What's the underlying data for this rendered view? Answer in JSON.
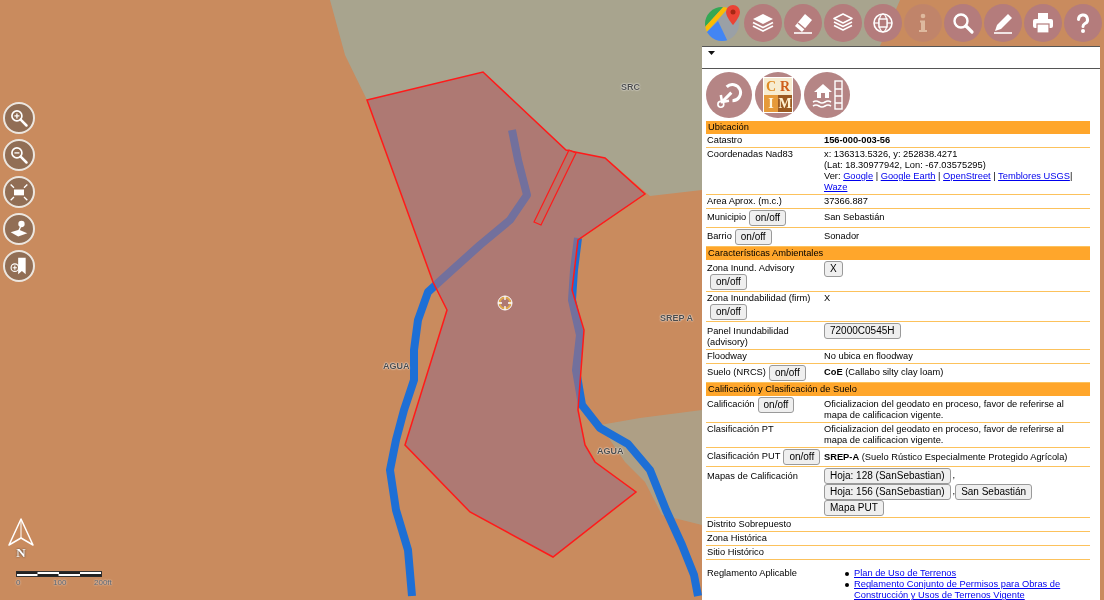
{
  "map": {
    "labels": [
      {
        "text": "SRC"
      },
      {
        "text": "SREP A"
      },
      {
        "text": "AGUA"
      },
      {
        "text": "AGUA"
      }
    ],
    "tools": [
      {
        "kind": "zoom_in"
      },
      {
        "kind": "zoom_out"
      },
      {
        "kind": "extent"
      },
      {
        "kind": "pin"
      },
      {
        "kind": "bookmark"
      }
    ],
    "north_arrow": {
      "label": "N"
    },
    "scale_bar": {
      "labels": [
        "0",
        "100",
        "200ft"
      ]
    }
  },
  "toolbar": [
    {
      "kind": "map",
      "disabled": false
    },
    {
      "kind": "layers",
      "disabled": false
    },
    {
      "kind": "eraser",
      "disabled": false
    },
    {
      "kind": "layers_alt",
      "disabled": false
    },
    {
      "kind": "globe",
      "disabled": false
    },
    {
      "kind": "info",
      "disabled": true
    },
    {
      "kind": "search",
      "disabled": false
    },
    {
      "kind": "draw",
      "disabled": false
    },
    {
      "kind": "print",
      "disabled": false
    },
    {
      "kind": "help",
      "disabled": false
    }
  ],
  "panel": {
    "shortcuts": [
      {
        "kind": "link"
      },
      {
        "kind": "logo",
        "letters": [
          "C",
          "R",
          "I",
          "M"
        ]
      },
      {
        "kind": "flood"
      }
    ],
    "sections": [
      {
        "title": "Ubicación",
        "rows": [
          {
            "label": "Catastro",
            "lines": [
              [
                {
                  "kind": "strong",
                  "text": "156-000-003-56"
                }
              ]
            ]
          },
          {
            "label": "Coordenadas Nad83",
            "lines": [
              [
                {
                  "kind": "text",
                  "text": "x: 136313.5326, y: 252838.4271"
                }
              ],
              [
                {
                  "kind": "text",
                  "text": "(Lat: 18.30977942, Lon: -67.03575295)"
                }
              ],
              [
                {
                  "kind": "text",
                  "text": "Ver: "
                },
                {
                  "kind": "link",
                  "text": "Google"
                },
                {
                  "kind": "sep",
                  "text": " | "
                },
                {
                  "kind": "link",
                  "text": "Google Earth"
                },
                {
                  "kind": "sep",
                  "text": " | "
                },
                {
                  "kind": "link",
                  "text": "OpenStreet"
                },
                {
                  "kind": "sep",
                  "text": " | "
                },
                {
                  "kind": "link",
                  "text": "Temblores USGS"
                },
                {
                  "kind": "sep",
                  "text": "| "
                },
                {
                  "kind": "link",
                  "text": "Waze"
                }
              ]
            ]
          },
          {
            "label": "Area Aprox. (m.c.)",
            "lines": [
              [
                {
                  "kind": "text",
                  "text": "37366.887"
                }
              ]
            ]
          },
          {
            "label": "Municipio",
            "toggle": "on/off",
            "lines": [
              [
                {
                  "kind": "text",
                  "text": "San Sebastián"
                }
              ]
            ]
          },
          {
            "label": "Barrio",
            "toggle": "on/off",
            "lines": [
              [
                {
                  "kind": "text",
                  "text": "Sonador"
                }
              ]
            ]
          }
        ]
      },
      {
        "title": "Características Ambientales",
        "rows": [
          {
            "label": "Zona Inund. Advisory",
            "toggle": "on/off",
            "lines": [
              [
                {
                  "kind": "button",
                  "text": "X"
                }
              ]
            ]
          },
          {
            "label": "Zona Inundabilidad (firm)",
            "toggle": "on/off",
            "lines": [
              [
                {
                  "kind": "text",
                  "text": "X"
                }
              ]
            ]
          },
          {
            "label": "Panel Inundabilidad (advisory)",
            "lines": [
              [
                {
                  "kind": "button",
                  "text": "72000C0545H"
                }
              ]
            ]
          },
          {
            "label": "Floodway",
            "lines": [
              [
                {
                  "kind": "text",
                  "text": "No ubica en floodway"
                }
              ]
            ]
          },
          {
            "label": "Suelo (NRCS)",
            "toggle": "on/off",
            "lines": [
              [
                {
                  "kind": "rich",
                  "text": "**CoE** (Callabo silty clay loam)"
                }
              ]
            ]
          }
        ]
      },
      {
        "title": "Calificación y Clasificación de Suelo",
        "rows": [
          {
            "label": "Calificación",
            "toggle": "on/off",
            "lines": [
              [
                {
                  "kind": "text",
                  "text": "Oficializacion del geodato en proceso, favor de referirse al mapa de calificacion vigente."
                }
              ]
            ]
          },
          {
            "label": "Clasificación PT",
            "lines": [
              [
                {
                  "kind": "text",
                  "text": "Oficializacion del geodato en proceso, favor de referirse al mapa de calificacion vigente."
                }
              ]
            ]
          },
          {
            "label": "Clasificación PUT",
            "toggle": "on/off",
            "lines": [
              [
                {
                  "kind": "rich",
                  "text": "**SREP-A** (Suelo Rústico Especialmente Protegido Agrícola)"
                }
              ]
            ]
          },
          {
            "label": "Mapas de Calificación",
            "lines": [
              [
                {
                  "kind": "button",
                  "text": "Hoja: 128 (SanSebastian)"
                },
                {
                  "kind": "sep",
                  "text": ","
                }
              ],
              [
                {
                  "kind": "button",
                  "text": "Hoja: 156 (SanSebastian)"
                },
                {
                  "kind": "sep",
                  "text": ","
                },
                {
                  "kind": "button",
                  "text": "San Sebastián"
                }
              ],
              [
                {
                  "kind": "button",
                  "text": "Mapa PUT"
                }
              ]
            ]
          },
          {
            "label": "Distrito Sobrepuesto"
          },
          {
            "label": "Zona Histórica"
          },
          {
            "label": "Sitio Histórico"
          }
        ]
      }
    ],
    "regulations": {
      "label": "Reglamento Aplicable",
      "links": [
        "Plan de Uso de Terrenos",
        "Reglamento Conjunto de Permisos para Obras de Construcción y Usos de Terrenos Vigente"
      ]
    }
  }
}
